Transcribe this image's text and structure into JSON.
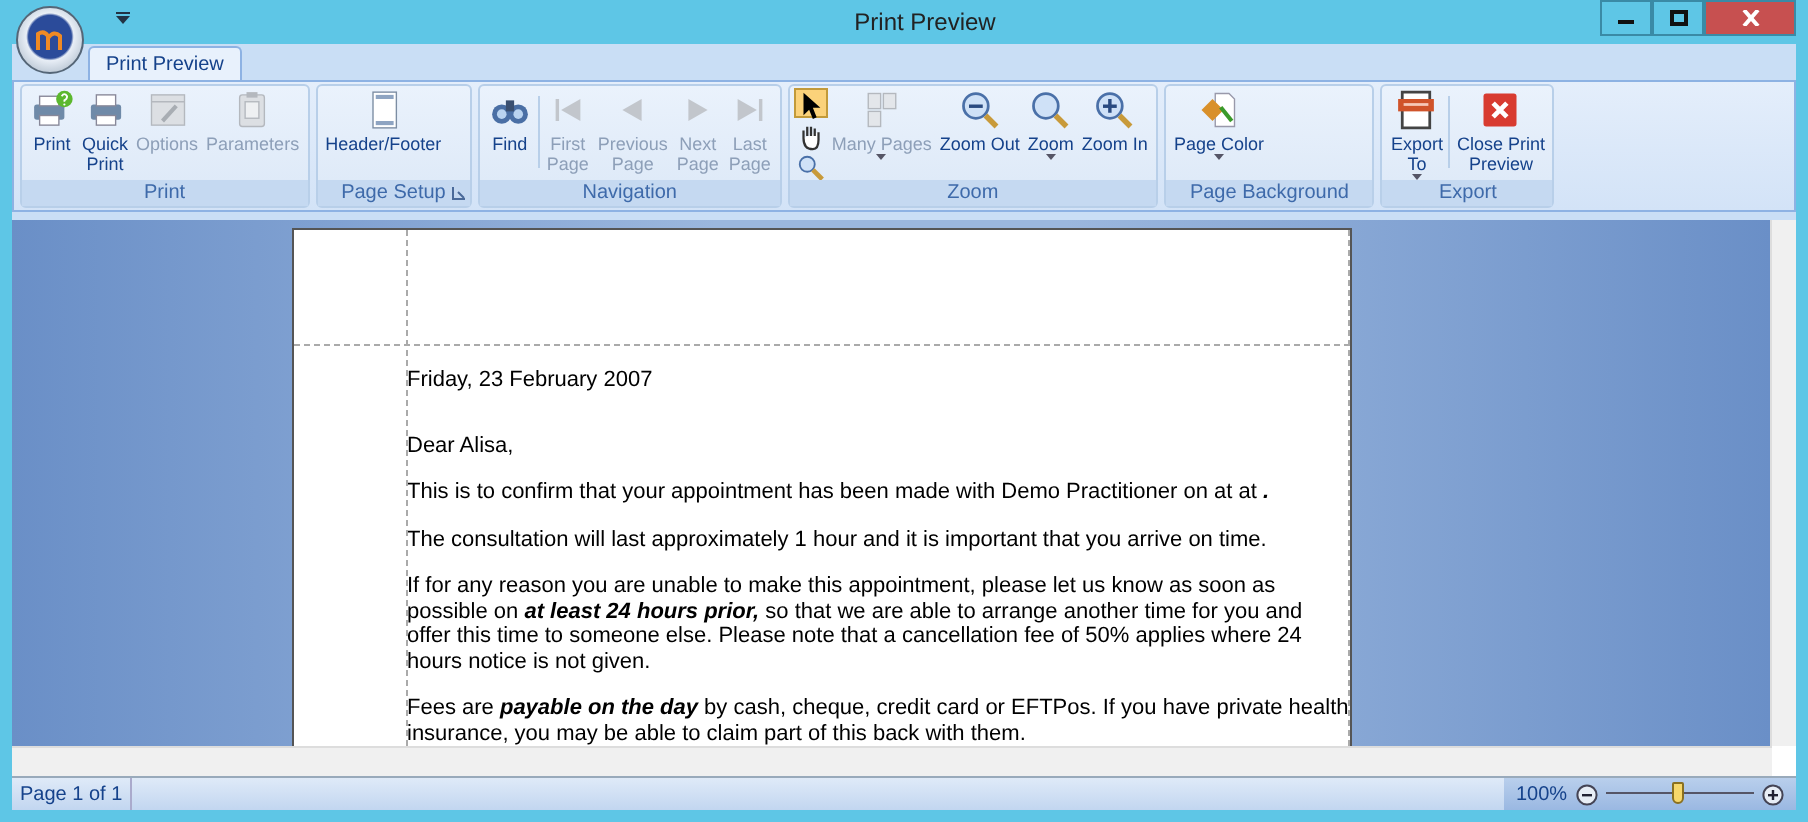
{
  "window": {
    "title": "Print Preview"
  },
  "tabs": [
    {
      "label": "Print Preview",
      "selected": true
    }
  ],
  "ribbon_groups": [
    {
      "title": "Print",
      "buttons": [
        {
          "label": "Print",
          "disabled": false
        },
        {
          "label": "Quick\nPrint",
          "disabled": false
        },
        {
          "label": "Options",
          "disabled": true
        },
        {
          "label": "Parameters",
          "disabled": true
        }
      ]
    },
    {
      "title": "Page Setup",
      "launcher": true,
      "buttons": [
        {
          "label": "Header/Footer",
          "disabled": false
        }
      ]
    },
    {
      "title": "Navigation",
      "buttons": [
        {
          "label": "Find",
          "disabled": false
        },
        {
          "label": "First\nPage",
          "disabled": true
        },
        {
          "label": "Previous\nPage",
          "disabled": true
        },
        {
          "label": "Next\nPage",
          "disabled": true
        },
        {
          "label": "Last\nPage",
          "disabled": true
        }
      ]
    },
    {
      "title": "Zoom",
      "tools": [
        {
          "selected": true
        },
        {
          "selected": false
        },
        {
          "selected": false
        }
      ],
      "buttons": [
        {
          "label": "Many Pages",
          "disabled": true,
          "dropdown": true
        },
        {
          "label": "Zoom Out",
          "disabled": false
        },
        {
          "label": "Zoom",
          "disabled": false,
          "dropdown": true
        },
        {
          "label": "Zoom In",
          "disabled": false
        }
      ]
    },
    {
      "title": "Page Background",
      "buttons": [
        {
          "label": "Page Color",
          "disabled": false,
          "dropdown": true
        }
      ]
    },
    {
      "title": "Export",
      "buttons": [
        {
          "label": "Export\nTo",
          "disabled": false,
          "dropdown": true
        },
        {
          "label": "Close Print\nPreview",
          "disabled": false
        }
      ]
    }
  ],
  "document": {
    "date": "Friday, 23 February 2007",
    "paragraphs": [
      "Dear Alisa,",
      "This is to confirm that your appointment has been made with Demo Practitioner on  at  at **.**",
      "The consultation will last approximately 1 hour and it is important that you arrive on time.",
      "If for any reason you are unable to make this appointment, please let us know as soon as possible on **at least 24 hours prior,** so that we are able to arrange another time for you and offer this time to someone else.  Please note that a cancellation fee of 50% applies where 24 hours notice is not given.",
      "Fees are **payable on the day** by cash, cheque, credit card or EFTPos.  If you have private health insurance, you may be able to claim part of this back with them."
    ]
  },
  "status_bar": {
    "page": "Page 1 of 1",
    "zoom": "100%",
    "zoom_slider": {
      "level": 0.49
    }
  }
}
